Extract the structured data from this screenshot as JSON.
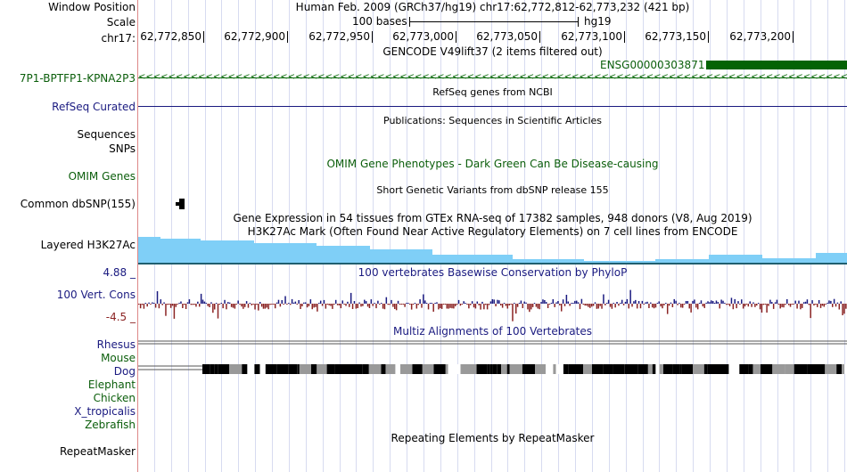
{
  "labels": {
    "window_position": "Window Position",
    "scale": "Scale",
    "chrom": "chr17:",
    "gencode_gene": "7P1-BPTFP1-KPNA2P3",
    "refseq": "RefSeq Curated",
    "sequences": "Sequences",
    "snps": "SNPs",
    "omim": "OMIM Genes",
    "common_dbsnp": "Common dbSNP(155)",
    "layered": "Layered H3K27Ac",
    "vert_max": "4.88 _",
    "vert_cons": "100 Vert. Cons",
    "vert_min": "-4.5 _",
    "species": [
      "Rhesus",
      "Mouse",
      "Dog",
      "Elephant",
      "Chicken",
      "X_tropicalis",
      "Zebrafish"
    ],
    "repeatmasker": "RepeatMasker"
  },
  "header": {
    "assembly_position": "Human Feb. 2009 (GRCh37/hg19)   chr17:62,772,812-62,773,232 (421 bp)",
    "scale_left": "100 bases",
    "scale_right": "hg19",
    "ruler_ticks": [
      "62,772,850",
      "62,772,900",
      "62,772,950",
      "62,773,000",
      "62,773,050",
      "62,773,100",
      "62,773,150",
      "62,773,200"
    ]
  },
  "tracks": {
    "gencode_title": "GENCODE V49lift37 (2 items filtered out)",
    "gencode_item": "ENSG00000303871",
    "refseq_title": "RefSeq genes from NCBI",
    "publications_title": "Publications: Sequences in Scientific Articles",
    "omim_title": "OMIM Gene Phenotypes - Dark Green Can Be Disease-causing",
    "dbsnp_title": "Short Genetic Variants from dbSNP release 155",
    "gtex_title": "Gene Expression in 54 tissues from GTEx RNA-seq of 17382 samples, 948 donors (V8, Aug 2019)",
    "h3k_title": "H3K27Ac Mark (Often Found Near Active Regulatory Elements) on 7 cell lines from ENCODE",
    "phylop_title": "100 vertebrates Basewise Conservation by PhyloP",
    "multiz_title": "Multiz Alignments of 100 Vertebrates",
    "repeat_title": "Repeating Elements by RepeatMasker"
  },
  "colors": {
    "gencode": "#0b6a0b",
    "refseq": "#1a1a80",
    "h3k27ac": "#7fcff7",
    "phylop_pos": "#1a1a80",
    "phylop_neg": "#8b2323",
    "grid": "#d7dbf0"
  }
}
